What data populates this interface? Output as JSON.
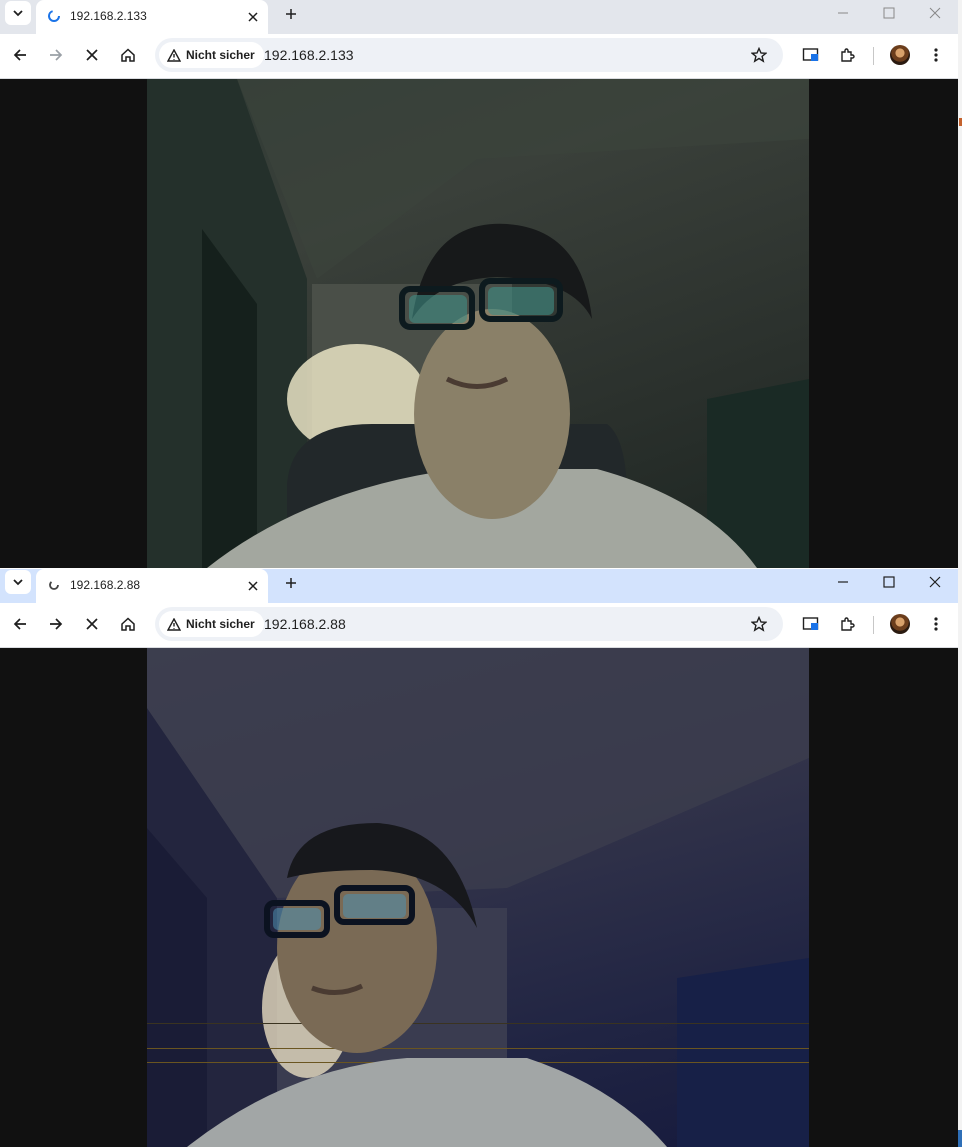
{
  "windows": [
    {
      "tab": {
        "title": "192.168.2.133"
      },
      "omnibox": {
        "security_label": "Nicht sicher",
        "url": "192.168.2.133"
      },
      "camera": {
        "description_icon": "webcam-video-feed"
      }
    },
    {
      "tab": {
        "title": "192.168.2.88"
      },
      "omnibox": {
        "security_label": "Nicht sicher",
        "url": "192.168.2.88"
      },
      "camera": {
        "description_icon": "webcam-video-feed"
      }
    }
  ],
  "colors": {
    "inactive_tabstrip": "#e3e6ec",
    "active_tabstrip": "#d3e3fd",
    "page_background": "#111111"
  }
}
